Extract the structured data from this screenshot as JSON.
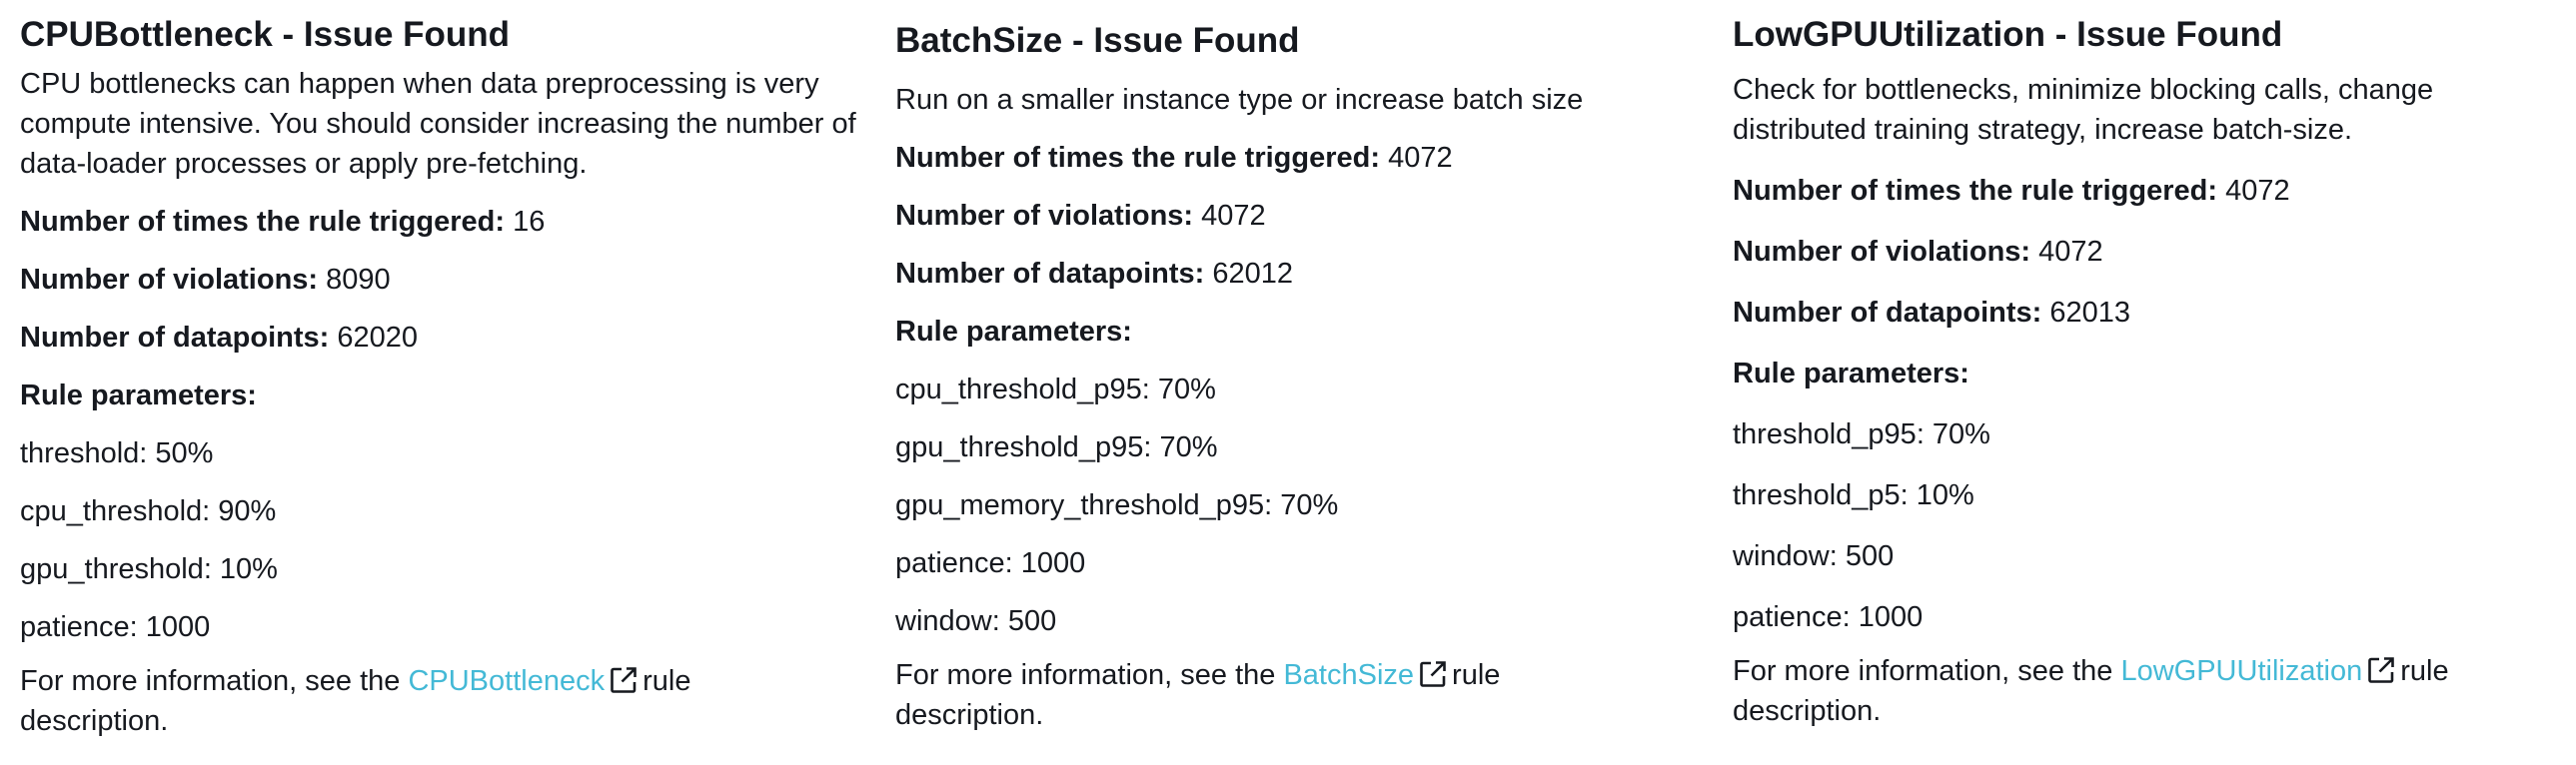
{
  "panels": [
    {
      "title": "CPUBottleneck - Issue Found",
      "description": "CPU bottlenecks can happen when data preprocessing is very compute intensive. You should consider increasing the number of data-loader processes or apply pre-fetching.",
      "stats": [
        {
          "label": "Number of times the rule triggered:",
          "value": "16"
        },
        {
          "label": "Number of violations:",
          "value": "8090"
        },
        {
          "label": "Number of datapoints:",
          "value": "62020"
        }
      ],
      "params_heading": "Rule parameters:",
      "params": [
        "threshold: 50%",
        "cpu_threshold: 90%",
        "gpu_threshold: 10%",
        "patience: 1000"
      ],
      "footer_prefix": "For more information, see the",
      "link_text": "CPUBottleneck",
      "footer_suffix": "rule",
      "footer_end": "description."
    },
    {
      "title": "BatchSize - Issue Found",
      "description": "Run on a smaller instance type or increase batch size",
      "stats": [
        {
          "label": "Number of times the rule triggered:",
          "value": "4072"
        },
        {
          "label": "Number of violations:",
          "value": "4072"
        },
        {
          "label": "Number of datapoints:",
          "value": "62012"
        }
      ],
      "params_heading": "Rule parameters:",
      "params": [
        "cpu_threshold_p95: 70%",
        "gpu_threshold_p95: 70%",
        "gpu_memory_threshold_p95: 70%",
        "patience: 1000",
        "window: 500"
      ],
      "footer_prefix": "For more information, see the",
      "link_text": "BatchSize",
      "footer_suffix": "rule",
      "footer_end": "description."
    },
    {
      "title": "LowGPUUtilization - Issue Found",
      "description": "Check for bottlenecks, minimize blocking calls, change distributed training strategy, increase batch-size.",
      "stats": [
        {
          "label": "Number of times the rule triggered:",
          "value": "4072"
        },
        {
          "label": "Number of violations:",
          "value": "4072"
        },
        {
          "label": "Number of datapoints:",
          "value": "62013"
        }
      ],
      "params_heading": "Rule parameters:",
      "params": [
        "threshold_p95: 70%",
        "threshold_p5: 10%",
        "window: 500",
        "patience: 1000"
      ],
      "footer_prefix": "For more information, see the",
      "link_text": "LowGPUUtilization",
      "footer_suffix": "rule",
      "footer_end": "description."
    }
  ],
  "icons": {
    "external_link": "external-link-icon"
  },
  "colors": {
    "link": "#44b9d6",
    "text": "#16191f"
  }
}
